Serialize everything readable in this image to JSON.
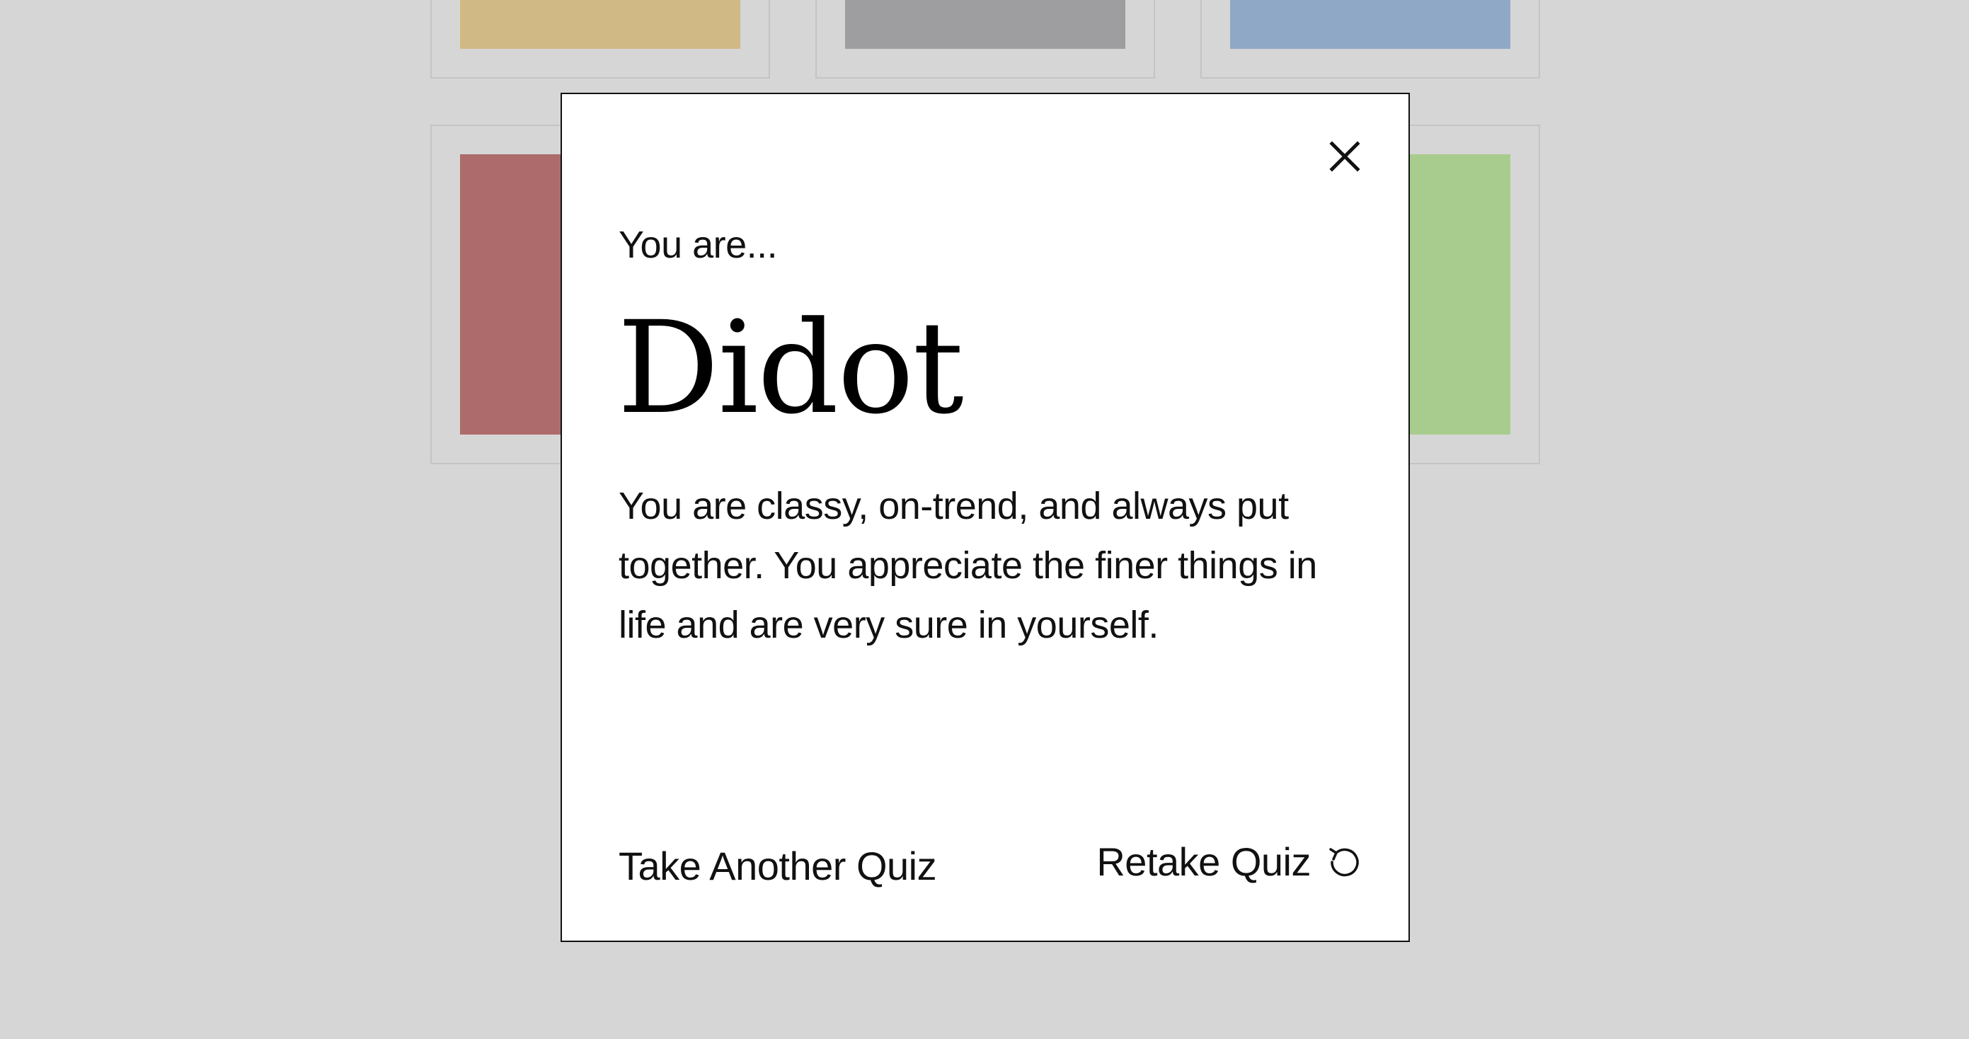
{
  "background": {
    "tiles": [
      {
        "name": "tile-yellow",
        "color": "#d1b985"
      },
      {
        "name": "tile-gray",
        "color": "#9e9ea0"
      },
      {
        "name": "tile-blue",
        "color": "#8fa8c6"
      },
      {
        "name": "tile-red",
        "color": "#ad6b6b"
      },
      {
        "name": "tile-green",
        "color": "#a8cc8e"
      }
    ]
  },
  "modal": {
    "eyebrow": "You are...",
    "title": "Didot",
    "description": "You are classy, on-trend, and always put together. You appreciate the finer things in life and are very sure in yourself.",
    "close_icon": "close-icon",
    "take_another_label": "Take Another Quiz",
    "retake_label": "Retake Quiz",
    "retake_icon": "refresh-icon"
  }
}
